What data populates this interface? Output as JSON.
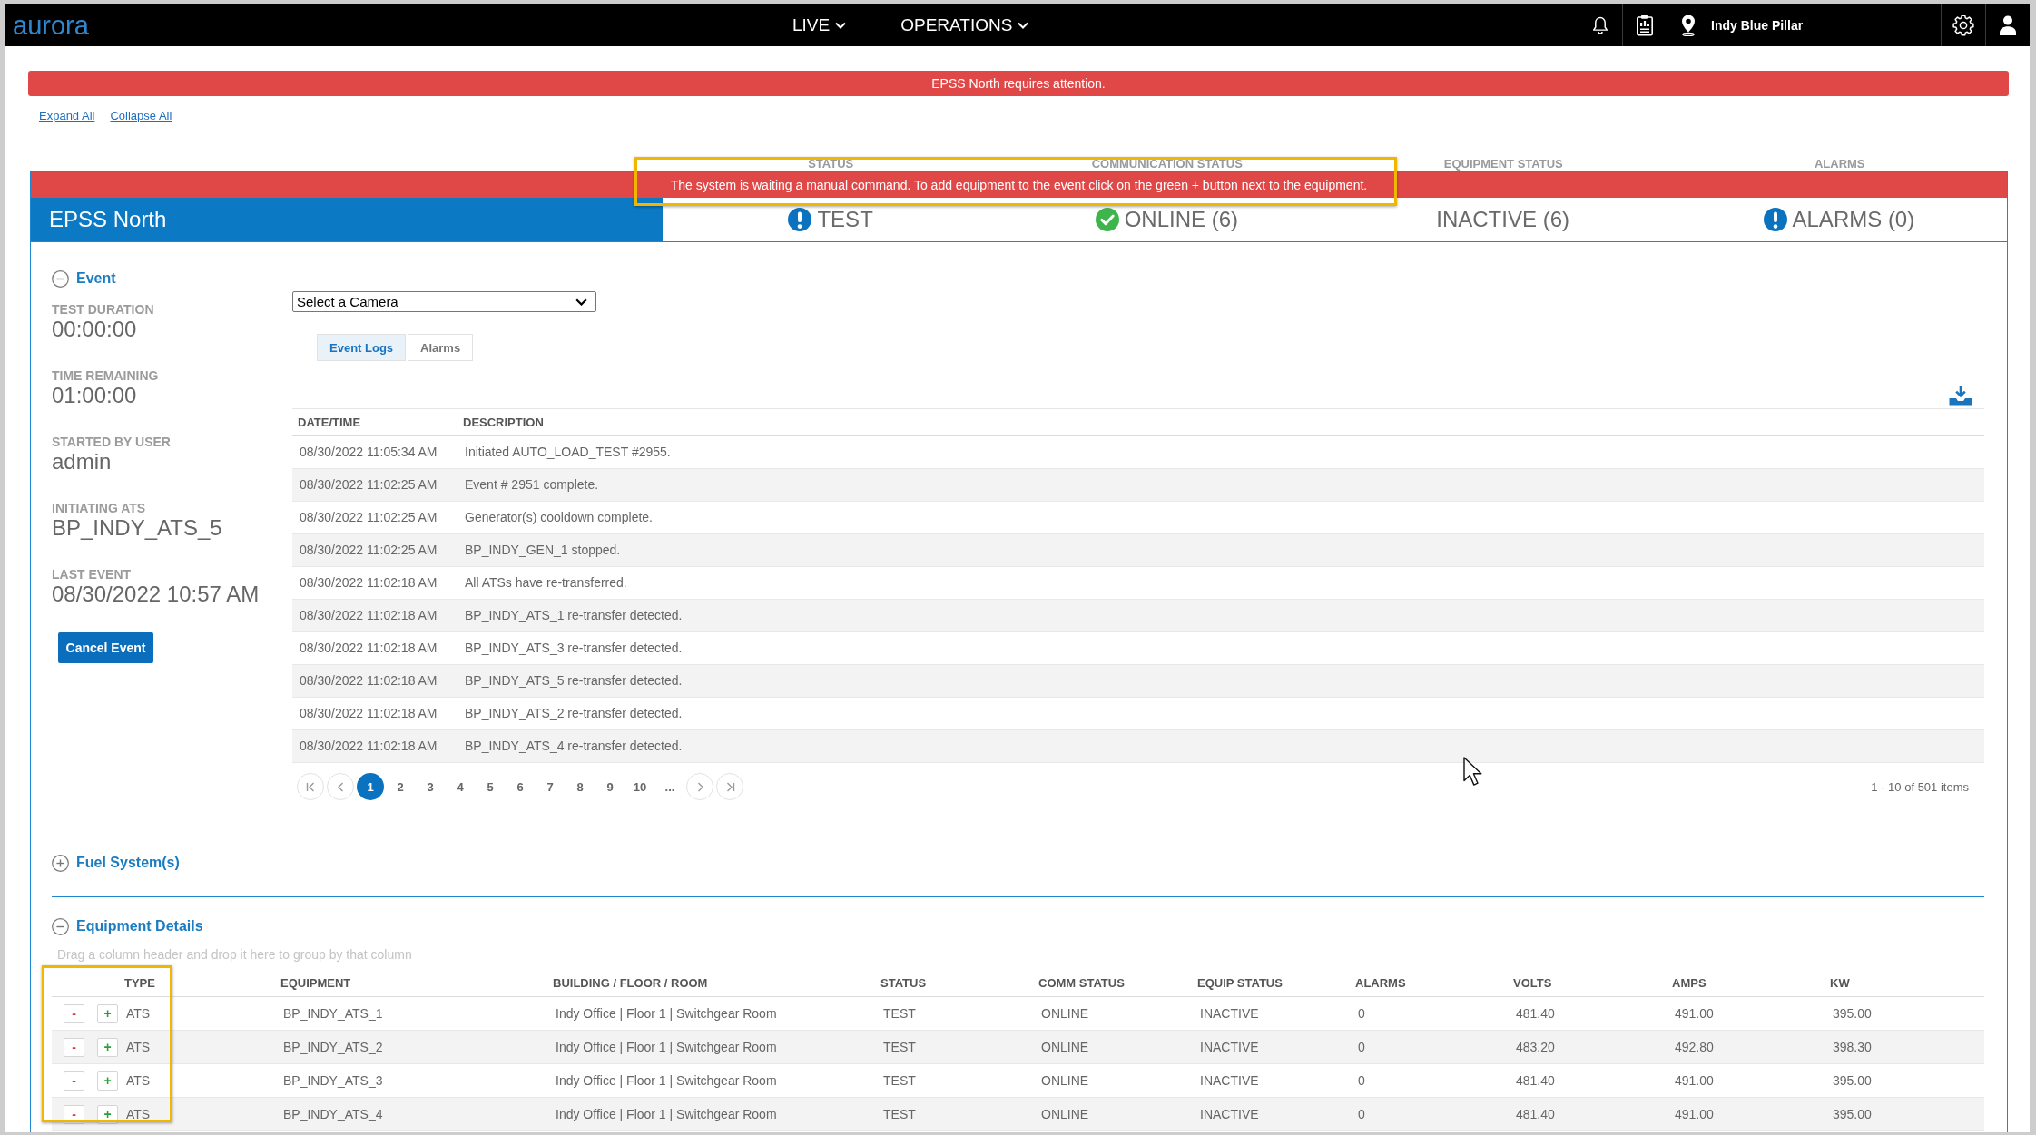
{
  "app": {
    "logo": "aurora"
  },
  "nav_menus": [
    {
      "label": "LIVE"
    },
    {
      "label": "OPERATIONS"
    }
  ],
  "site_selector": {
    "label": "Indy Blue Pillar"
  },
  "alert_banner": {
    "message": "EPSS North requires attention."
  },
  "links": [
    {
      "label": "Expand All"
    },
    {
      "label": "Collapse All"
    }
  ],
  "site_panel": {
    "status_columns": [
      {
        "heading": "STATUS",
        "value": "TEST",
        "kind": "alert"
      },
      {
        "heading": "COMMUNICATION STATUS",
        "value": "ONLINE (6)",
        "kind": "ok"
      },
      {
        "heading": "EQUIPMENT STATUS",
        "value": "INACTIVE (6)",
        "kind": "plain"
      },
      {
        "heading": "ALARMS",
        "value": "ALARMS (0)",
        "kind": "alert"
      }
    ],
    "message": "The system is waiting a manual command. To add equipment to the event click on the green + button next to the equipment.",
    "title": "EPSS North",
    "event_section": {
      "title": "Event",
      "expanded": true,
      "fields": [
        {
          "label": "TEST DURATION",
          "value": "00:00:00"
        },
        {
          "label": "TIME REMAINING",
          "value": "01:00:00"
        },
        {
          "label": "STARTED BY USER",
          "value": "admin"
        },
        {
          "label": "INITIATING ATS",
          "value": "BP_INDY_ATS_5"
        },
        {
          "label": "LAST EVENT",
          "value": "08/30/2022 10:57 AM"
        }
      ],
      "cancel_button": "Cancel Event",
      "camera_select": {
        "value": "Select a Camera"
      },
      "tabs": [
        {
          "label": "Event Logs",
          "selected": true
        },
        {
          "label": "Alarms",
          "selected": false
        }
      ],
      "log_table": {
        "columns": [
          "DATE/TIME",
          "DESCRIPTION"
        ],
        "rows": [
          [
            "08/30/2022 11:05:34 AM",
            "Initiated AUTO_LOAD_TEST #2955."
          ],
          [
            "08/30/2022 11:02:25 AM",
            "Event # 2951 complete."
          ],
          [
            "08/30/2022 11:02:25 AM",
            "Generator(s) cooldown complete."
          ],
          [
            "08/30/2022 11:02:25 AM",
            "BP_INDY_GEN_1 stopped."
          ],
          [
            "08/30/2022 11:02:18 AM",
            "All ATSs have re-transferred."
          ],
          [
            "08/30/2022 11:02:18 AM",
            "BP_INDY_ATS_1 re-transfer detected."
          ],
          [
            "08/30/2022 11:02:18 AM",
            "BP_INDY_ATS_3 re-transfer detected."
          ],
          [
            "08/30/2022 11:02:18 AM",
            "BP_INDY_ATS_5 re-transfer detected."
          ],
          [
            "08/30/2022 11:02:18 AM",
            "BP_INDY_ATS_2 re-transfer detected."
          ],
          [
            "08/30/2022 11:02:18 AM",
            "BP_INDY_ATS_4 re-transfer detected."
          ]
        ]
      },
      "pagination": {
        "pages": [
          {
            "label": "1",
            "selected": true
          },
          {
            "label": "2",
            "selected": false
          },
          {
            "label": "3",
            "selected": false
          },
          {
            "label": "4",
            "selected": false
          },
          {
            "label": "5",
            "selected": false
          },
          {
            "label": "6",
            "selected": false
          },
          {
            "label": "7",
            "selected": false
          },
          {
            "label": "8",
            "selected": false
          },
          {
            "label": "9",
            "selected": false
          },
          {
            "label": "10",
            "selected": false
          }
        ],
        "more": "...",
        "summary": "1 - 10 of 501 items"
      }
    },
    "fuel_section": {
      "title": "Fuel System(s)",
      "expanded": false
    },
    "equipment_section": {
      "title": "Equipment Details",
      "expanded": true,
      "group_hint": "Drag a column header and drop it here to group by that column",
      "table": {
        "columns": [
          "TYPE",
          "EQUIPMENT",
          "BUILDING / FLOOR / ROOM",
          "STATUS",
          "COMM STATUS",
          "EQUIP STATUS",
          "ALARMS",
          "VOLTS",
          "AMPS",
          "KW"
        ],
        "rows": [
          {
            "remove": "-",
            "add": "+",
            "cells": [
              "ATS",
              "BP_INDY_ATS_1",
              "Indy Office | Floor 1 | Switchgear Room",
              "TEST",
              "ONLINE",
              "INACTIVE",
              "0",
              "481.40",
              "491.00",
              "395.00"
            ]
          },
          {
            "remove": "-",
            "add": "+",
            "cells": [
              "ATS",
              "BP_INDY_ATS_2",
              "Indy Office | Floor 1 | Switchgear Room",
              "TEST",
              "ONLINE",
              "INACTIVE",
              "0",
              "483.20",
              "492.80",
              "398.30"
            ]
          },
          {
            "remove": "-",
            "add": "+",
            "cells": [
              "ATS",
              "BP_INDY_ATS_3",
              "Indy Office | Floor 1 | Switchgear Room",
              "TEST",
              "ONLINE",
              "INACTIVE",
              "0",
              "481.40",
              "491.00",
              "395.00"
            ]
          },
          {
            "remove": "-",
            "add": "+",
            "cells": [
              "ATS",
              "BP_INDY_ATS_4",
              "Indy Office | Floor 1 | Switchgear Room",
              "TEST",
              "ONLINE",
              "INACTIVE",
              "0",
              "481.40",
              "491.00",
              "395.00"
            ]
          }
        ]
      }
    }
  }
}
